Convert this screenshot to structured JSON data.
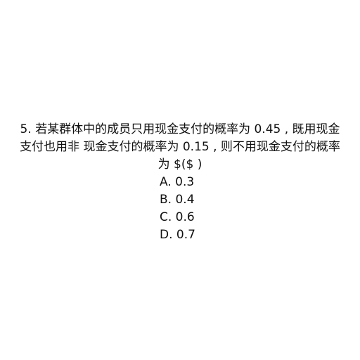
{
  "question": {
    "line1": "5.  若某群体中的成员只用现金支付的概率为 0.45 , 既用现金",
    "line2": "支付也用非 现金支付的概率为 0.15 , 则不用现金支付的概率",
    "line3": "为 $($ )"
  },
  "options": [
    {
      "text": "A. 0.3"
    },
    {
      "text": "B. 0.4"
    },
    {
      "text": "C. 0.6"
    },
    {
      "text": "D. 0.7"
    }
  ]
}
